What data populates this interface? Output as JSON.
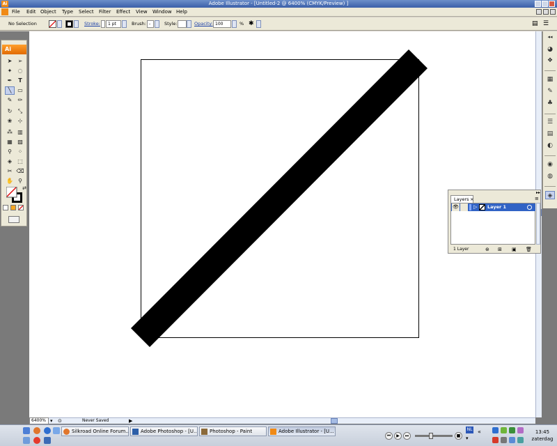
{
  "window": {
    "title": "Adobe Illustrator - [Untitled-2 @ 6400% (CMYK/Preview) ]",
    "app_badge": "Ai"
  },
  "menu": [
    "File",
    "Edit",
    "Object",
    "Type",
    "Select",
    "Filter",
    "Effect",
    "View",
    "Window",
    "Help"
  ],
  "control_bar": {
    "selection": "No Selection",
    "stroke_label": "Stroke:",
    "stroke_value": "1 pt",
    "brush_label": "Brush:",
    "brush_value": "-",
    "style_label": "Style:",
    "opacity_label": "Opacity:",
    "opacity_value": "100",
    "opacity_unit": "%"
  },
  "status": {
    "zoom": "6400%",
    "text": "Never Saved"
  },
  "layers_panel": {
    "tab": "Layers",
    "layer_name": "Layer 1",
    "count": "1 Layer"
  },
  "taskbar": {
    "tasks": [
      {
        "label": "Silkroad Online Forum...",
        "icon": "firefox-icon",
        "active": false
      },
      {
        "label": "Adobe Photoshop - [U...",
        "icon": "pen-icon",
        "active": false
      },
      {
        "label": "Photoshop - Paint",
        "icon": "paint-icon",
        "active": false
      },
      {
        "label": "Adobe Illustrator - [U...",
        "icon": "illustrator-icon",
        "active": true
      }
    ],
    "language": "NL",
    "time": "13:45",
    "day": "zaterdag"
  },
  "colors": {
    "accent": "#3163c5",
    "ai_orange": "#f08a16",
    "workspace": "#7a7a7a"
  }
}
